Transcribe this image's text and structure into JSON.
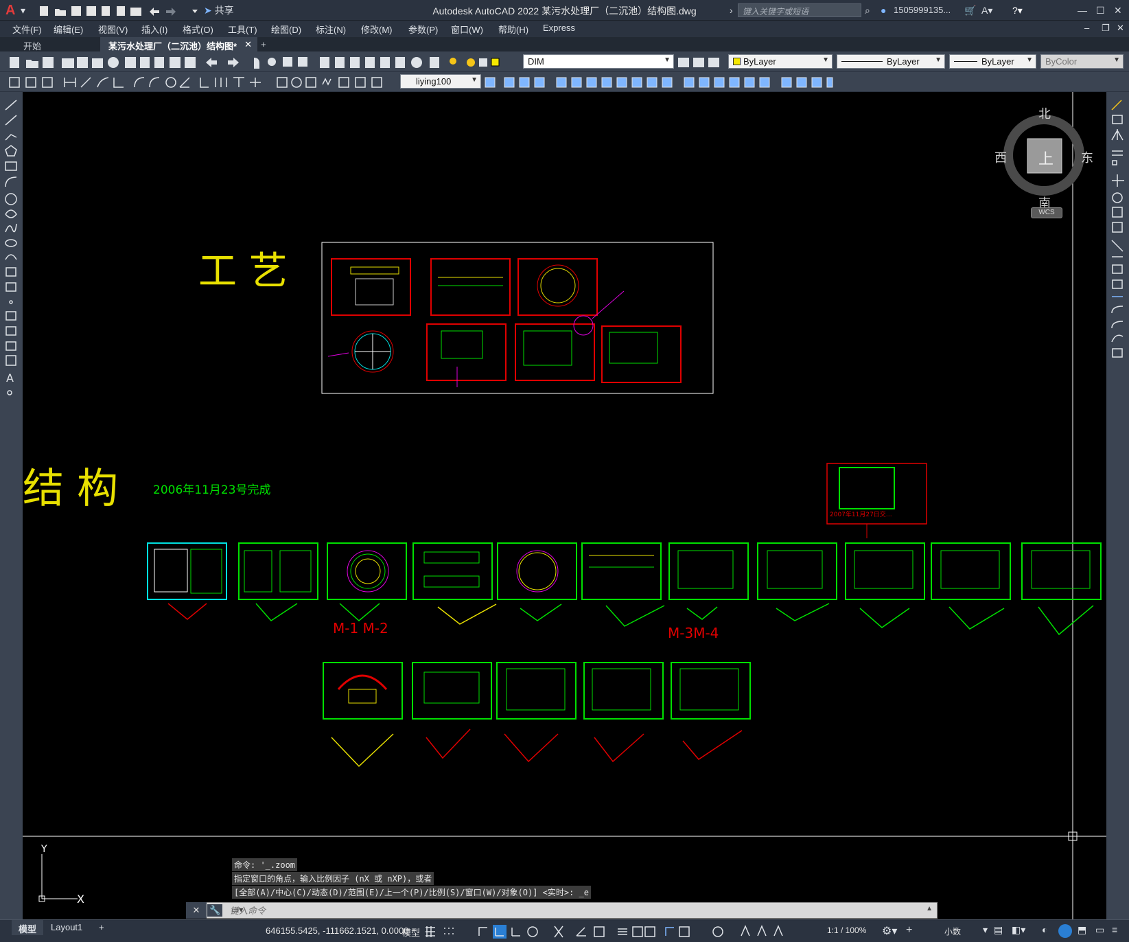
{
  "app": {
    "title": "Autodesk AutoCAD 2022    某污水处理厂（二沉池）结构图.dwg",
    "share_label": "共享",
    "search_placeholder": "键入关键字或短语",
    "user": "1505999135...",
    "colors": {
      "chrome": "#2b3340",
      "toolbar": "#3b4452",
      "accent": "#e23b3b"
    }
  },
  "menu": [
    "文件(F)",
    "编辑(E)",
    "视图(V)",
    "插入(I)",
    "格式(O)",
    "工具(T)",
    "绘图(D)",
    "标注(N)",
    "修改(M)",
    "参数(P)",
    "窗口(W)",
    "帮助(H)",
    "Express"
  ],
  "tabs": [
    {
      "label": "开始"
    },
    {
      "label": "某污水处理厂（二沉池）结构图*"
    }
  ],
  "toolbar1": {
    "layer": "DIM",
    "color": "ByLayer",
    "linetype": "ByLayer",
    "lineweight": "ByLayer",
    "plotstyle": "ByColor"
  },
  "toolbar2": {
    "dimstyle": "liying100"
  },
  "viewcube": {
    "north": "北",
    "south": "南",
    "east": "东",
    "west": "西",
    "top": "上",
    "wcs": "WCS"
  },
  "drawing": {
    "heading_process": "工  艺",
    "heading_structure": "结  构",
    "date_note": "2006年11月23号完成",
    "note_2007": "2007年11月27日交…",
    "label_m1m2": "M-1 M-2",
    "label_m3m4": "M-3M-4",
    "ucs_y": "Y",
    "ucs_x": "X"
  },
  "command": {
    "history": [
      "命令: '_.zoom",
      "指定窗口的角点，输入比例因子 (nX 或 nXP)，或者",
      "[全部(A)/中心(C)/动态(D)/范围(E)/上一个(P)/比例(S)/窗口(W)/对象(O)] <实时>: _e"
    ],
    "placeholder": "键入命令"
  },
  "status": {
    "layout_tabs": [
      "模型",
      "Layout1"
    ],
    "coords": "646155.5425, -111662.1521, 0.0000",
    "space": "模型",
    "scale": "1:1 / 100%",
    "units": "小数"
  }
}
